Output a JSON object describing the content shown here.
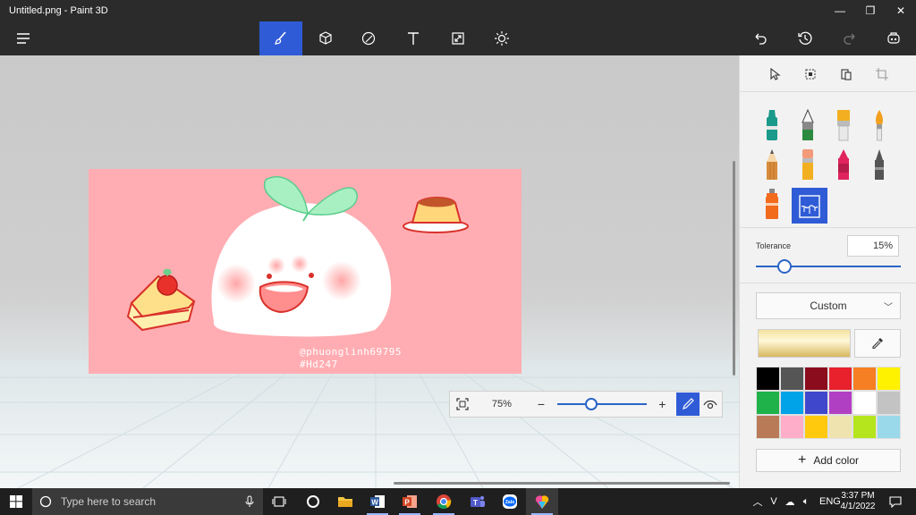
{
  "window": {
    "title": "Untitled.png - Paint 3D",
    "minimize": "—",
    "maximize": "❐",
    "close": "✕"
  },
  "toolbar": {
    "tools": [
      {
        "name": "brushes-tool",
        "icon": "brush-icon",
        "active": true
      },
      {
        "name": "3d-shapes-tool",
        "icon": "cube-icon"
      },
      {
        "name": "stickers-tool",
        "icon": "sticker-icon"
      },
      {
        "name": "text-tool",
        "icon": "text-icon"
      },
      {
        "name": "canvas-tool",
        "icon": "resize-icon"
      },
      {
        "name": "effects-tool",
        "icon": "sun-icon"
      }
    ],
    "right": [
      "undo-icon",
      "history-icon",
      "redo-icon",
      "mixed-reality-icon"
    ]
  },
  "canvas": {
    "watermark_line1": "@phuonglinh69795",
    "watermark_line2": "#Hd247",
    "background": "#ffadb2"
  },
  "zoom": {
    "percent": "75%",
    "level": 0.38
  },
  "panel": {
    "selection_icons": [
      "select-icon",
      "crop-select-icon",
      "paste-icon",
      "crop-icon"
    ],
    "brushes": [
      {
        "name": "marker",
        "color": "#1a9a8a"
      },
      {
        "name": "calligraphy-pen",
        "color": "#2b8a3e"
      },
      {
        "name": "oil-brush",
        "color": "#f2b020"
      },
      {
        "name": "watercolor",
        "color": "#f2a020"
      },
      {
        "name": "pencil",
        "color": "#d98c3c"
      },
      {
        "name": "eraser",
        "color": "#f29a7a"
      },
      {
        "name": "crayon",
        "color": "#e0245e"
      },
      {
        "name": "pixel-pen",
        "color": "#555555"
      },
      {
        "name": "spray-can",
        "color": "#f26b1d"
      },
      {
        "name": "fill",
        "color": "#2f5bd6",
        "active": true
      }
    ],
    "tolerance_label": "Tolerance",
    "tolerance_value": "15%",
    "tolerance_level": 0.15,
    "color_mode": "Custom",
    "current_color": "#f2e2a0",
    "palette": [
      "#000000",
      "#555555",
      "#8a0c1d",
      "#e8212d",
      "#f57f22",
      "#fff200",
      "#1fb24a",
      "#00a2e8",
      "#3f48cc",
      "#b13fc4",
      "#ffffff",
      "#c3c3c3",
      "#b97a57",
      "#ffaec9",
      "#ffc90e",
      "#efe4b0",
      "#b5e61d",
      "#99d9ea"
    ],
    "add_color": "Add color"
  },
  "taskbar": {
    "search_placeholder": "Type here to search",
    "apps": [
      "task-view",
      "cortana",
      "file-explorer",
      "word",
      "powerpoint",
      "chrome",
      "teams",
      "zalo",
      "paint-3d"
    ],
    "language": "ENG",
    "time": "3:37 PM",
    "date": "4/1/2022"
  }
}
